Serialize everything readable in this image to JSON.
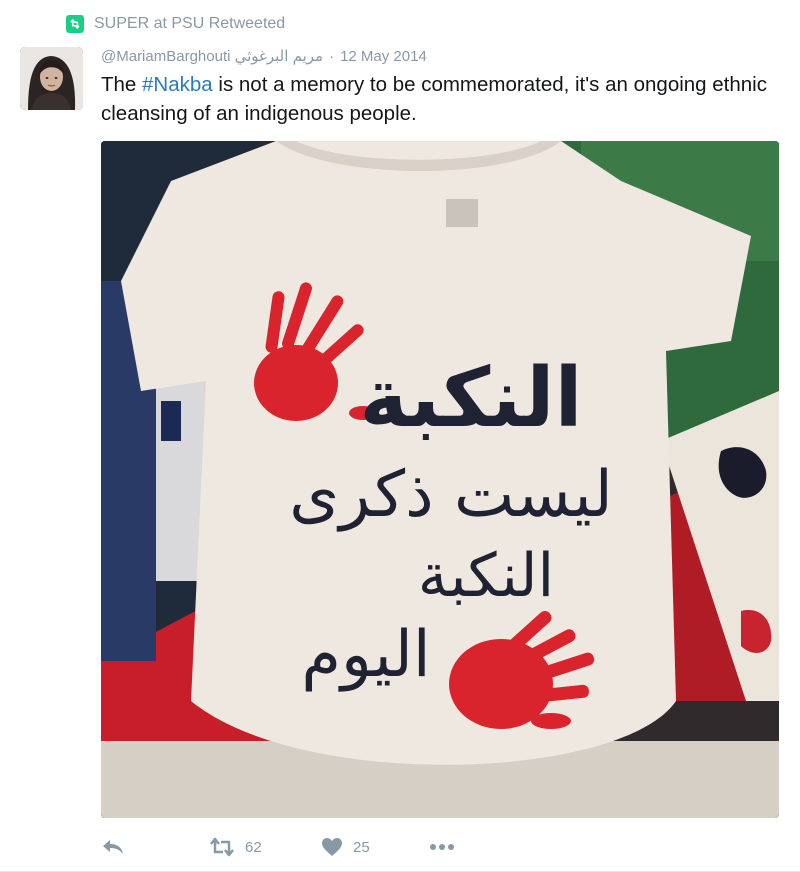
{
  "retweet_context": {
    "icon": "retweet-icon",
    "text": "SUPER at PSU Retweeted"
  },
  "author": {
    "handle_and_name": "@MariamBarghouti مريم البرغوثي",
    "separator": "·",
    "date": "12 May 2014"
  },
  "tweet": {
    "text_before": "The ",
    "hashtag": "#Nakba",
    "text_after": " is not a memory to be commemorated, it's an ongoing ethnic cleansing of an indigenous people."
  },
  "media": {
    "shirt_text_lines": [
      "النكبة",
      "ليست ذكرى",
      "النكبة",
      "اليوم"
    ],
    "colors": {
      "shirt": "#efe8e0",
      "hand": "#d9242e",
      "ink": "#1f2233"
    }
  },
  "actions": {
    "reply_icon": "reply-icon",
    "retweet_icon": "retweet-icon",
    "retweet_count": "62",
    "like_icon": "heart-icon",
    "like_count": "25",
    "more_icon": "more-dots-icon"
  },
  "colors": {
    "muted": "#8899a6",
    "link": "#2b7bb9",
    "retweet_green": "#19cf86"
  }
}
